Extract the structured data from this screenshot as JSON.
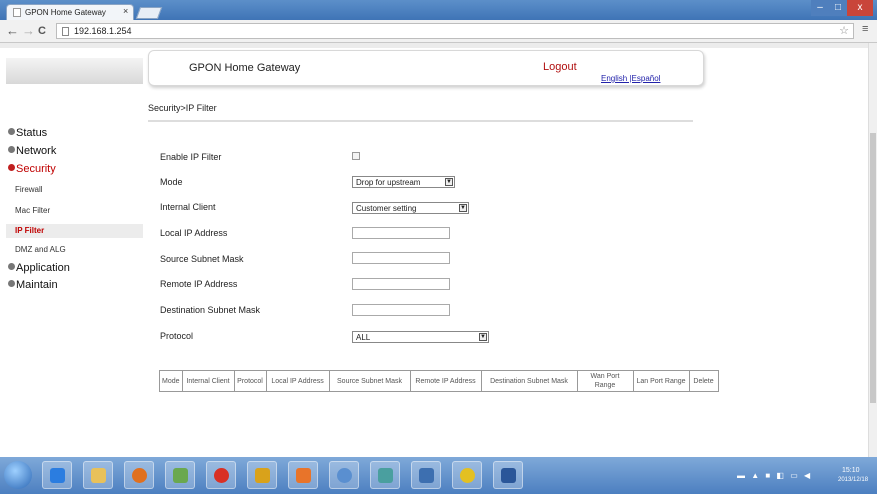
{
  "browser": {
    "tab_title": "GPON Home Gateway",
    "tab_close": "×",
    "url": "192.168.1.254",
    "back": "←",
    "forward": "→",
    "reload": "C",
    "star": "☆",
    "menu": "≡"
  },
  "header": {
    "title": "GPON Home Gateway",
    "logout": "Logout",
    "language": "English |Español"
  },
  "breadcrumb": "Security>IP Filter",
  "sidebar": {
    "status": "Status",
    "network": "Network",
    "security": "Security",
    "firewall": "Firewall",
    "mac_filter": "Mac Filter",
    "ip_filter": "IP Filter",
    "dmz_alg": "DMZ and ALG",
    "application": "Application",
    "maintain": "Maintain"
  },
  "form": {
    "enable_label": "Enable IP Filter",
    "enable_checked": false,
    "mode_label": "Mode",
    "mode_value": "Drop for upstream",
    "internal_client_label": "Internal Client",
    "internal_client_value": "Customer setting",
    "local_ip_label": "Local IP Address",
    "local_ip_value": "",
    "src_mask_label": "Source Subnet Mask",
    "src_mask_value": "",
    "remote_ip_label": "Remote IP Address",
    "remote_ip_value": "",
    "dst_mask_label": "Destination Subnet Mask",
    "dst_mask_value": "",
    "protocol_label": "Protocol",
    "protocol_value": "ALL"
  },
  "table": {
    "headers": [
      "Mode",
      "Internal Client",
      "Protocol",
      "Local IP Address",
      "Source Subnet Mask",
      "Remote IP Address",
      "Destination Subnet Mask",
      "Wan Port Range",
      "Lan Port Range",
      "Delete"
    ]
  },
  "taskbar": {
    "time": "15:10",
    "date": "2013/12/18",
    "tray": "▬ ▲ ■ ◧ ▭ ◀"
  },
  "colors": {
    "active_nav": "#c00000",
    "logout": "#b01010",
    "title_bar": "#3f74b6"
  }
}
